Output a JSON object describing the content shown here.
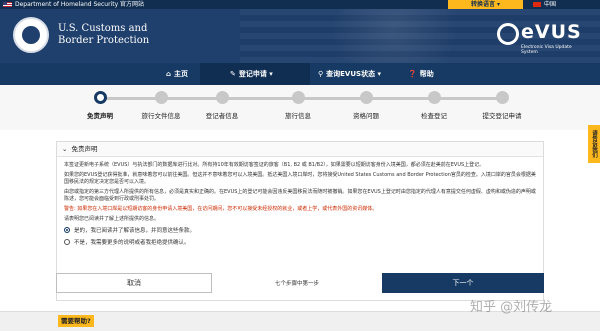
{
  "top_bar": {
    "dhs_label": "Department of Homeland Security 官方网站",
    "language_button": "转换语言 ▾",
    "language_current": "中国"
  },
  "header": {
    "agency_line1": "U.S. Customs and",
    "agency_line2": "Border Protection",
    "evus_logo": "eVUS",
    "evus_subtitle": "Electronic Visa Update System"
  },
  "nav": {
    "items": [
      {
        "label": "主页",
        "icon": "home-icon"
      },
      {
        "label": "登记申请 ▾",
        "icon": "edit-icon",
        "active": true
      },
      {
        "label": "查询EVUS状态 ▾",
        "icon": "search-icon"
      },
      {
        "label": "帮助",
        "icon": "help-icon"
      }
    ]
  },
  "stepper": {
    "steps": [
      "免责声明",
      "旅行文件信息",
      "登记者信息",
      "旅行信息",
      "资格问题",
      "检查登记",
      "提交登记申请"
    ],
    "current_index": 0
  },
  "panel": {
    "title": "免责声明",
    "paragraphs": [
      "本签证更新电子系统（EVUS）与执法部门的数据库进行比对。所有持10年有效期访客签证的旅客（B1, B2 或 B1/B2），如果需要以短期访客身份入境美国，都必须在赴美前在EVUS上登记。",
      "如果您的EVUS登记获得批准，就意味着您可以前往美国。但这并不意味着您可以入境美国。抵达美国入境口岸时，您将接受United States Customs and Border Protection官员的检查。入境口岸的官员会根据美国移民法的规定决定您是否可以入境。",
      "由您或指定的第三方代理人所提供的所有信息，必须是真实和正确的。在EVUS上的登记可能会因违反美国移民法而随时被撤销。如果您在EVUS上登记时由您指定的代理人有意提交任何虚假、虚构和或伪造的声明或陈述，您可能会面临受到行政或刑事处罚。"
    ],
    "warning": "警告: 如果您在入境口岸是以短期访客的身份申请入境美国，在访问期间，您不可以接受未经授权的就业，或者上学，或代表外国的资讯媒体。",
    "prompt": "请表明您已阅读并了解上述所提供的信息。",
    "options": [
      {
        "label": "是的，我已阅读并了解该信息，并同意这些条款。",
        "selected": true
      },
      {
        "label": "不是，我需要更多的说明或者我拒绝提供确认。",
        "selected": false
      }
    ]
  },
  "footer": {
    "cancel_label": "取消",
    "step_info": "七个步骤中第一步",
    "next_label": "下一个"
  },
  "help_tag": "需要帮助?",
  "feedback_tab": "请告诉我们",
  "watermark": "知乎 @刘传龙",
  "colors": {
    "navy": "#163a63",
    "header_blue": "#1f3f6c",
    "accent_yellow": "#fdb81e",
    "warning_red": "#cc2a00"
  }
}
